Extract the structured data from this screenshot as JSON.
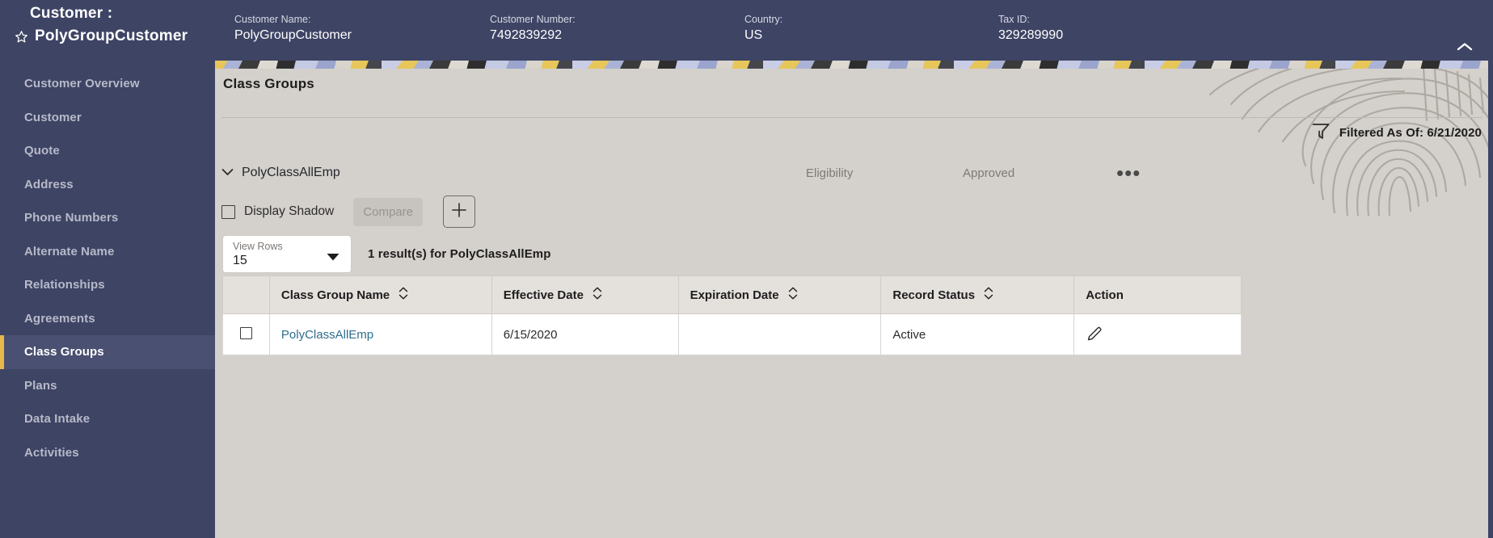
{
  "header": {
    "title_prefix": "Customer :",
    "customer_display_name": "PolyGroupCustomer",
    "star_icon": "star-outline-icon",
    "collapse_icon": "chevron-up-icon",
    "fields": [
      {
        "label": "Customer Name:",
        "value": "PolyGroupCustomer"
      },
      {
        "label": "Customer Number:",
        "value": "7492839292"
      },
      {
        "label": "Country:",
        "value": "US"
      },
      {
        "label": "Tax ID:",
        "value": "329289990"
      }
    ],
    "background_color": "#3e4464"
  },
  "sidebar": {
    "active_accent_color": "#e8b84b",
    "items": [
      {
        "label": "Customer Overview",
        "active": false
      },
      {
        "label": "Customer",
        "active": false
      },
      {
        "label": "Quote",
        "active": false
      },
      {
        "label": "Address",
        "active": false
      },
      {
        "label": "Phone Numbers",
        "active": false
      },
      {
        "label": "Alternate Name",
        "active": false
      },
      {
        "label": "Relationships",
        "active": false
      },
      {
        "label": "Agreements",
        "active": false
      },
      {
        "label": "Class Groups",
        "active": true
      },
      {
        "label": "Plans",
        "active": false
      },
      {
        "label": "Data Intake",
        "active": false
      },
      {
        "label": "Activities",
        "active": false
      }
    ]
  },
  "main": {
    "page_title": "Class Groups",
    "filter": {
      "icon": "filter-funnel-icon",
      "label": "Filtered As Of: 6/21/2020"
    },
    "section": {
      "expand_icon": "chevron-down-icon",
      "name": "PolyClassAllEmp",
      "eligibility_label": "Eligibility",
      "approved_label": "Approved",
      "overflow_icon": "ellipsis-horizontal-icon",
      "overflow_label": "•••"
    },
    "toolbar": {
      "display_shadow_label": "Display Shadow",
      "display_shadow_checked": false,
      "compare_label": "Compare",
      "compare_disabled": true,
      "add_icon": "plus-icon"
    },
    "rows_select": {
      "label": "View Rows",
      "value": "15",
      "caret_icon": "chevron-down-icon"
    },
    "result_count": "1 result(s) for PolyClassAllEmp",
    "table": {
      "sort_icon": "sort-updown-icon",
      "columns": [
        {
          "label": "",
          "sortable": false
        },
        {
          "label": "Class Group Name",
          "sortable": true
        },
        {
          "label": "Effective Date",
          "sortable": true
        },
        {
          "label": "Expiration Date",
          "sortable": true
        },
        {
          "label": "Record Status",
          "sortable": true
        },
        {
          "label": "Action",
          "sortable": false
        }
      ],
      "rows": [
        {
          "selected": false,
          "class_group_name": "PolyClassAllEmp",
          "effective_date": "6/15/2020",
          "expiration_date": "",
          "record_status": "Active",
          "action_icon": "pencil-edit-icon"
        }
      ]
    },
    "link_color": "#2e6f8e",
    "panel_color": "#d4d0cb"
  }
}
